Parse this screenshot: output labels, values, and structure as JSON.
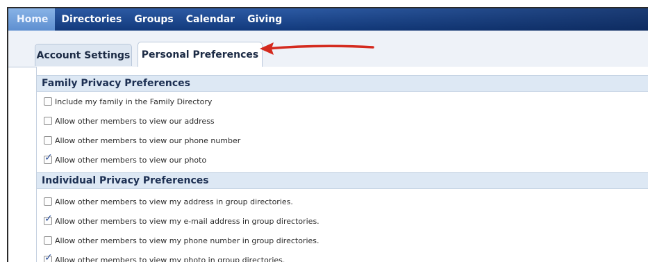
{
  "nav": {
    "items": [
      {
        "label": "Home",
        "active": true
      },
      {
        "label": "Directories",
        "active": false
      },
      {
        "label": "Groups",
        "active": false
      },
      {
        "label": "Calendar",
        "active": false
      },
      {
        "label": "Giving",
        "active": false
      }
    ]
  },
  "tabs": [
    {
      "label": "Account Settings",
      "active": false
    },
    {
      "label": "Personal Preferences",
      "active": true
    }
  ],
  "annotation": {
    "icon": "red-arrow-icon",
    "color": "#d42a1e"
  },
  "family_section": {
    "title": "Family Privacy Preferences",
    "options": [
      {
        "label": "Include my family in the Family Directory",
        "checked": false
      },
      {
        "label": "Allow other members to view our address",
        "checked": false
      },
      {
        "label": "Allow other members to view our phone number",
        "checked": false
      },
      {
        "label": "Allow other members to view our photo",
        "checked": true
      }
    ]
  },
  "individual_section": {
    "title": "Individual Privacy Preferences",
    "options": [
      {
        "label": "Allow other members to view my address in group directories.",
        "checked": false
      },
      {
        "label": "Allow other members to view my e-mail address in group directories.",
        "checked": true
      },
      {
        "label": "Allow other members to view my phone number in group directories.",
        "checked": false
      },
      {
        "label": "Allow other members to view my photo in group directories.",
        "checked": true
      }
    ]
  }
}
